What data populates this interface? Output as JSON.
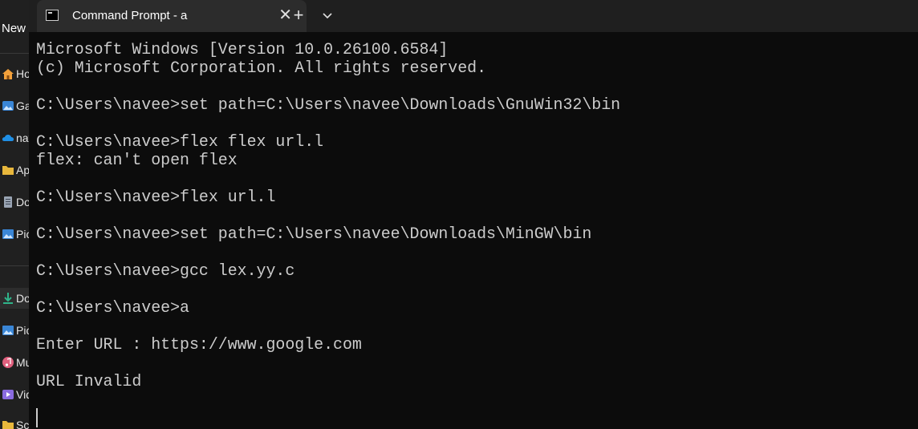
{
  "explorer": {
    "new_label": "New",
    "items": [
      {
        "label": "Home",
        "icon": "home-icon",
        "color": "#f3a13b"
      },
      {
        "label": "Gallery",
        "icon": "gallery-icon",
        "color": "#3a86d6"
      },
      {
        "label": "naveen - Personal",
        "icon": "onedrive-icon",
        "color": "#1f8fe5"
      },
      {
        "label": "Apps",
        "icon": "folder-icon",
        "color": "#e8b73c"
      },
      {
        "label": "Documents",
        "icon": "document-icon",
        "color": "#9aa5b4"
      },
      {
        "label": "Pictures",
        "icon": "pictures-icon",
        "color": "#3a86d6"
      },
      {
        "label": "Downloads",
        "icon": "download-icon",
        "color": "#2fb48a"
      },
      {
        "label": "Pictures",
        "icon": "pictures-icon",
        "color": "#3a86d6"
      },
      {
        "label": "Music",
        "icon": "music-icon",
        "color": "#e0607e"
      },
      {
        "label": "Videos",
        "icon": "videos-icon",
        "color": "#8a6be0"
      },
      {
        "label": "Screenshots",
        "icon": "folder-icon",
        "color": "#e8b73c"
      }
    ]
  },
  "tab": {
    "title": "Command Prompt - a",
    "close_glyph": "✕",
    "new_tab_glyph": "+"
  },
  "console": {
    "lines": [
      "Microsoft Windows [Version 10.0.26100.6584]",
      "(c) Microsoft Corporation. All rights reserved.",
      "",
      "C:\\Users\\navee>set path=C:\\Users\\navee\\Downloads\\GnuWin32\\bin",
      "",
      "C:\\Users\\navee>flex flex url.l",
      "flex: can't open flex",
      "",
      "C:\\Users\\navee>flex url.l",
      "",
      "C:\\Users\\navee>set path=C:\\Users\\navee\\Downloads\\MinGW\\bin",
      "",
      "C:\\Users\\navee>gcc lex.yy.c",
      "",
      "C:\\Users\\navee>a",
      "",
      "Enter URL : https://www.google.com",
      "",
      "URL Invalid"
    ]
  },
  "colors": {
    "console_bg": "#0c0c0c",
    "console_text": "#cccccc",
    "tab_bg": "#2c2c2c",
    "tabbar_bg": "#1f1f1f"
  }
}
